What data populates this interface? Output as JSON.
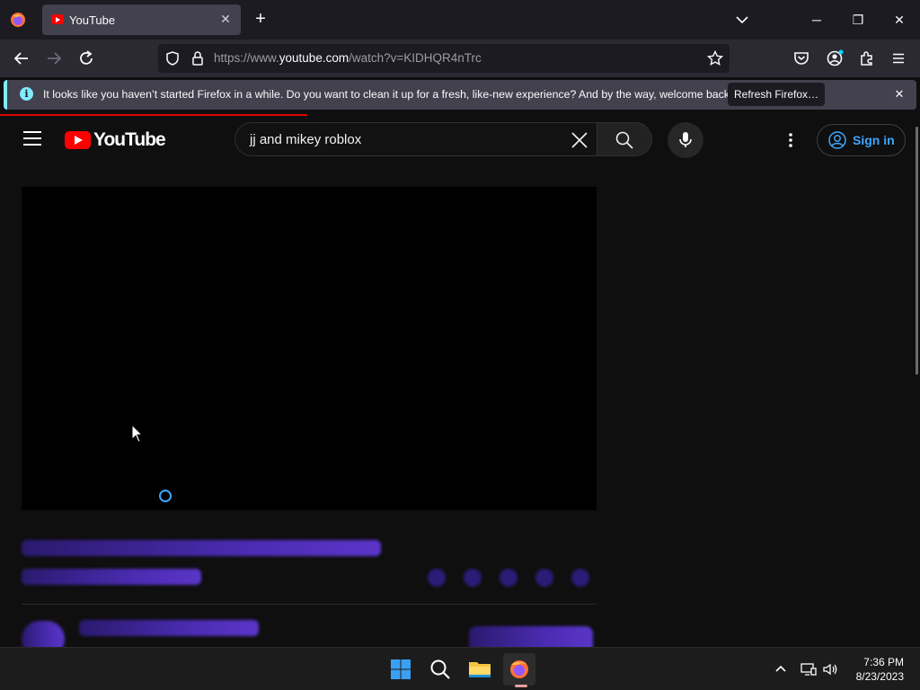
{
  "browser": {
    "tab": {
      "title": "YouTube"
    },
    "url": {
      "prefix": "https://www.",
      "host": "youtube.com",
      "path": "/watch?v=KIDHQR4nTrc"
    },
    "notification": {
      "message": "It looks like you haven’t started Firefox in a while. Do you want to clean it up for a fresh, like-new experience? And by the way, welcome back!",
      "button_label": "Refresh Firefox…"
    },
    "colors": {
      "toolbar": "#2b2a33",
      "tabstrip": "#1c1b22",
      "accent": "#80ebff",
      "page_load": "#e00000"
    }
  },
  "youtube": {
    "logo_text": "YouTube",
    "search": {
      "value": "jj and mikey roblox"
    },
    "signin_label": "Sign in",
    "colors": {
      "brand_red": "#ff0000",
      "link_blue": "#3ea6ff",
      "background": "#0f0f0f"
    }
  },
  "taskbar": {
    "time": "7:36 PM",
    "date": "8/23/2023",
    "apps": [
      "start-icon",
      "search-icon",
      "file-explorer-icon",
      "firefox-icon"
    ]
  }
}
